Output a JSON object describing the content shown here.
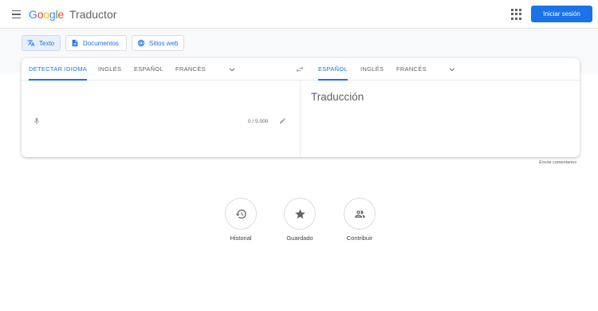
{
  "header": {
    "logo": [
      "G",
      "o",
      "o",
      "g",
      "l",
      "e"
    ],
    "product_name": "Traductor",
    "signin_label": "Iniciar sesión"
  },
  "modes": [
    {
      "label": "Texto",
      "icon": "translate-icon",
      "active": true
    },
    {
      "label": "Documentos",
      "icon": "document-icon",
      "active": false
    },
    {
      "label": "Sitios web",
      "icon": "globe-icon",
      "active": false
    }
  ],
  "source_langs": [
    {
      "label": "DETECTAR IDIOMA",
      "active": true
    },
    {
      "label": "INGLÉS",
      "active": false
    },
    {
      "label": "ESPAÑOL",
      "active": false
    },
    {
      "label": "FRANCÉS",
      "active": false
    }
  ],
  "target_langs": [
    {
      "label": "ESPAÑOL",
      "active": true
    },
    {
      "label": "INGLÉS",
      "active": false
    },
    {
      "label": "FRANCÉS",
      "active": false
    }
  ],
  "source": {
    "value": "",
    "char_count": "0 / 5.000"
  },
  "target": {
    "placeholder": "Traducción"
  },
  "feedback_link": "Enviar comentarios",
  "bottom_items": [
    {
      "label": "Historial",
      "icon": "history-icon"
    },
    {
      "label": "Guardado",
      "icon": "star-icon"
    },
    {
      "label": "Contribuir",
      "icon": "people-icon"
    }
  ],
  "colors": {
    "accent": "#1a73e8",
    "active_mode_bg": "#e8f0fe",
    "muted_text": "#5f6368"
  }
}
